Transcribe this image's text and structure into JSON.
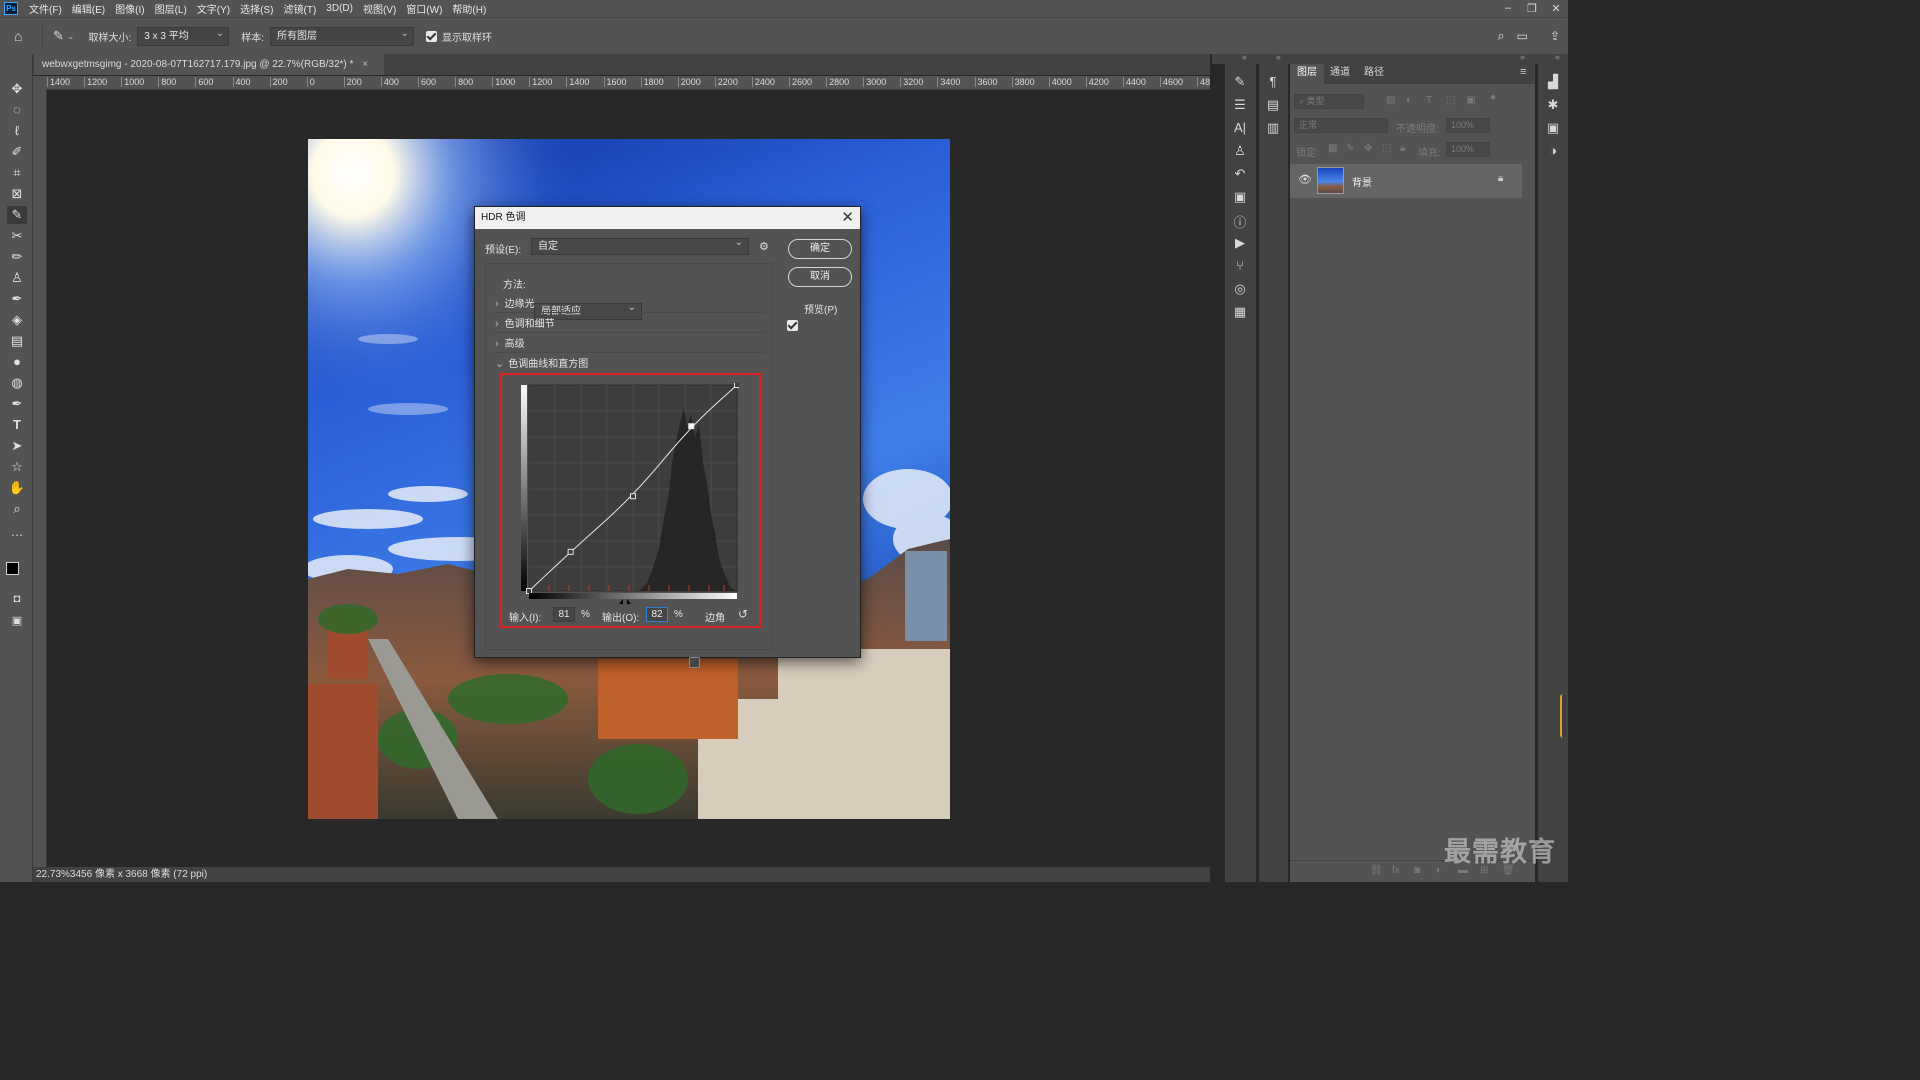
{
  "app": {
    "logo": "Ps"
  },
  "menu": [
    "文件(F)",
    "编辑(E)",
    "图像(I)",
    "图层(L)",
    "文字(Y)",
    "选择(S)",
    "滤镜(T)",
    "3D(D)",
    "视图(V)",
    "窗口(W)",
    "帮助(H)"
  ],
  "options_bar": {
    "sample_size_label": "取样大小:",
    "sample_size_value": "3 x 3 平均",
    "sample_label": "样本:",
    "sample_value": "所有图层",
    "show_ring_label": "显示取样环",
    "show_ring_checked": true
  },
  "document": {
    "tab_title": "webwxgetmsgimg - 2020-08-07T162717.179.jpg @ 22.7%(RGB/32*) *",
    "ruler_labels": [
      "1400",
      "1200",
      "1000",
      "800",
      "600",
      "400",
      "200",
      "0",
      "200",
      "400",
      "600",
      "800",
      "1000",
      "1200",
      "1400",
      "1600",
      "1800",
      "2000",
      "2200",
      "2400",
      "2600",
      "2800",
      "3000",
      "3200",
      "3400",
      "3600",
      "3800",
      "4000",
      "4200",
      "4400",
      "4600",
      "48"
    ],
    "status_text": "22.73%3456 像素 x 3668 像素 (72 ppi)"
  },
  "dialog": {
    "title": "HDR 色调",
    "preset_label": "预设(E):",
    "preset_value": "自定",
    "method_label": "方法:",
    "method_value": "局部适应",
    "ok_label": "确定",
    "cancel_label": "取消",
    "preview_label": "预览(P)",
    "preview_checked": true,
    "sections": [
      "边缘光",
      "色调和细节",
      "高级",
      "色调曲线和直方图"
    ],
    "input_label": "输入(I):",
    "input_value": "81",
    "percent": "%",
    "output_label": "输出(O):",
    "output_value": "82",
    "corner_label": "边角",
    "curve_points": [
      [
        0,
        0
      ],
      [
        20,
        19
      ],
      [
        50,
        46
      ],
      [
        78,
        80
      ],
      [
        100,
        100
      ]
    ]
  },
  "layers_panel": {
    "tabs": [
      "图层",
      "通道",
      "路径"
    ],
    "filter_placeholder": "类型",
    "blend_mode": "正常",
    "opacity_label": "不透明度:",
    "opacity_value": "100%",
    "lock_label": "锁定:",
    "fill_label": "填充:",
    "fill_value": "100%",
    "layer_name": "背景"
  },
  "watermark": "最需教育",
  "colors": {
    "accent_red": "#e02020",
    "ps_blue": "#31a8ff"
  }
}
